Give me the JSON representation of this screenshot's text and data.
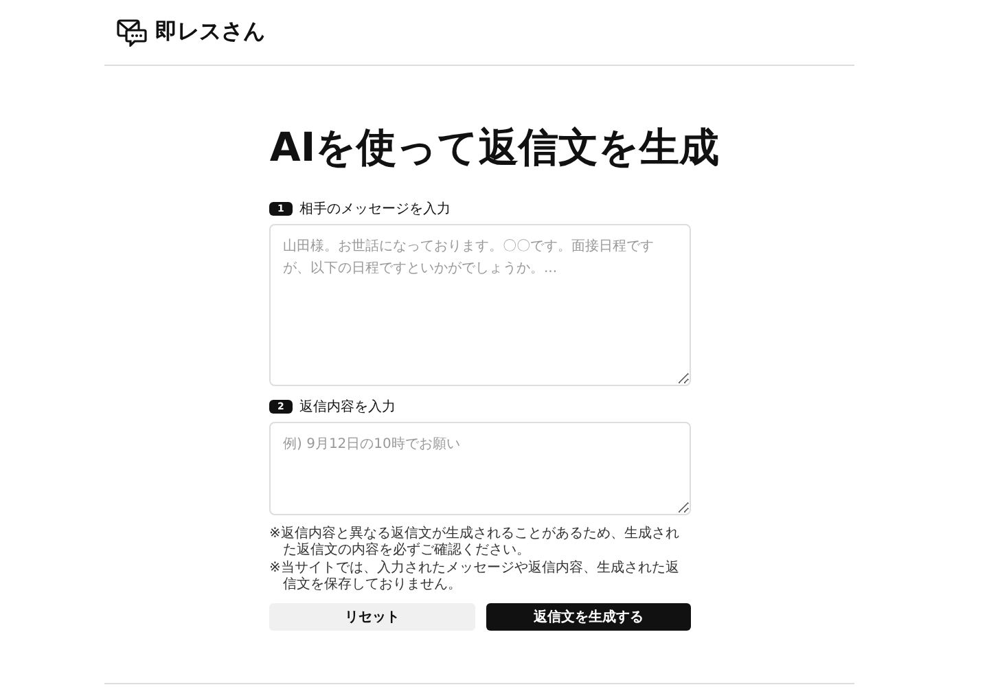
{
  "header": {
    "logo_text": "即レスさん"
  },
  "title": "AIを使って返信文を生成",
  "fields": [
    {
      "number": "1",
      "label": "相手のメッセージを入力",
      "placeholder": "山田様。お世話になっております。〇〇です。面接日程ですが、以下の日程ですといかがでしょうか。...",
      "kind": "multiline"
    },
    {
      "number": "2",
      "label": "返信内容を入力",
      "placeholder": "例) 9月12日の10時でお願い",
      "kind": "short"
    }
  ],
  "notes": [
    "※返信内容と異なる返信文が生成されることがあるため、生成された返信文の内容を必ずご確認ください。",
    "※当サイトでは、入力されたメッセージや返信内容、生成された返信文を保存しておりません。"
  ],
  "buttons": [
    {
      "label": "リセット",
      "kind": "secondary"
    },
    {
      "label": "返信文を生成する",
      "kind": "primary"
    }
  ]
}
